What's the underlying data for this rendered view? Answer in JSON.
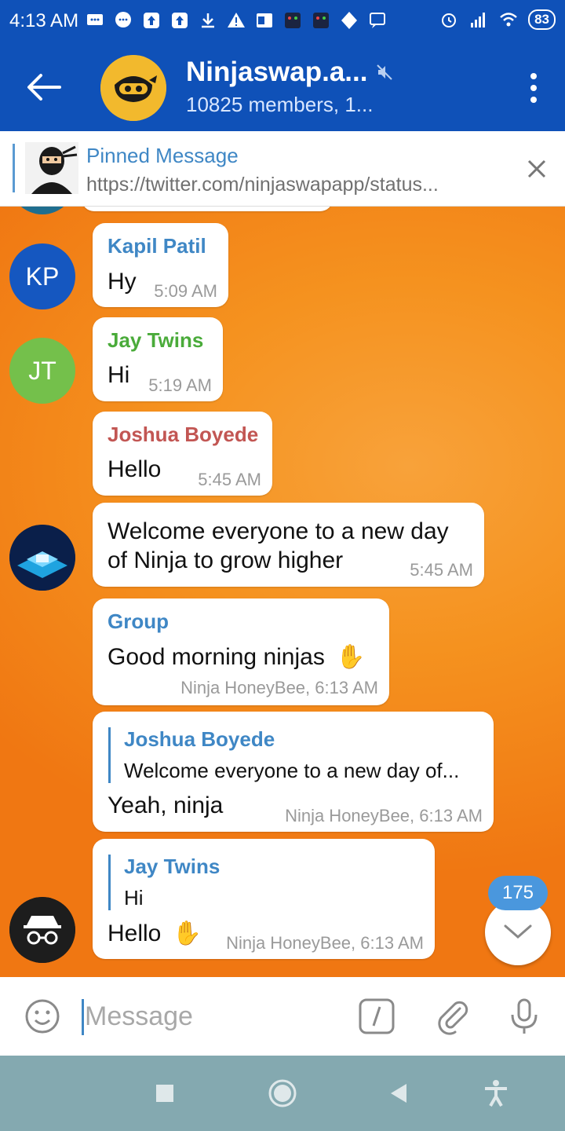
{
  "status_bar": {
    "time": "4:13 AM",
    "battery": "83",
    "icons": [
      "chat-bubble-icon",
      "messenger-icon",
      "upload-icon",
      "upload-icon",
      "download-icon",
      "warning-icon",
      "outlook-icon",
      "app-icon",
      "app-icon",
      "shield-icon",
      "message-icon",
      "alarm-icon",
      "signal-icon",
      "wifi-icon",
      "battery-icon"
    ]
  },
  "header": {
    "title": "Ninjaswap.a...",
    "subtitle": "10825 members, 1...",
    "muted": true
  },
  "pinned": {
    "title": "Pinned Message",
    "text": "https://twitter.com/ninjaswapapp/status..."
  },
  "messages": [
    {
      "sender": "Kapil Patil",
      "sender_color": "#3f87c5",
      "text": "Hy",
      "time": "5:09 AM",
      "avatar_initials": "KP",
      "avatar_color": "#1557c0"
    },
    {
      "sender": "Jay Twins",
      "sender_color": "#4aab3a",
      "text": "Hi",
      "time": "5:19 AM",
      "avatar_initials": "JT",
      "avatar_color": "#74c04b"
    },
    {
      "sender": "Joshua Boyede",
      "sender_color": "#c25653",
      "text": "Hello",
      "time": "5:45 AM"
    },
    {
      "text_line1": "Welcome everyone to a new day",
      "text_line2": "of Ninja to grow higher",
      "time": "5:45 AM"
    },
    {
      "sender": "Group",
      "sender_color": "#3f87c5",
      "text": "Good morning ninjas",
      "time": "Ninja HoneyBee, 6:13 AM"
    },
    {
      "reply_to": {
        "name": "Joshua Boyede",
        "text": "Welcome everyone to a new day of..."
      },
      "text": "Yeah, ninja",
      "time": "Ninja HoneyBee, 6:13 AM"
    },
    {
      "reply_to": {
        "name": "Jay Twins",
        "text": "Hi"
      },
      "text": "Hello",
      "time": "Ninja HoneyBee, 6:13 AM"
    }
  ],
  "unread_count": "175",
  "input": {
    "placeholder": "Message"
  },
  "colors": {
    "brand_blue": "#0f51b8",
    "link_blue": "#3f87c5",
    "wallpaper_orange": "#f5921f",
    "nav_bar": "#84a9b0"
  }
}
